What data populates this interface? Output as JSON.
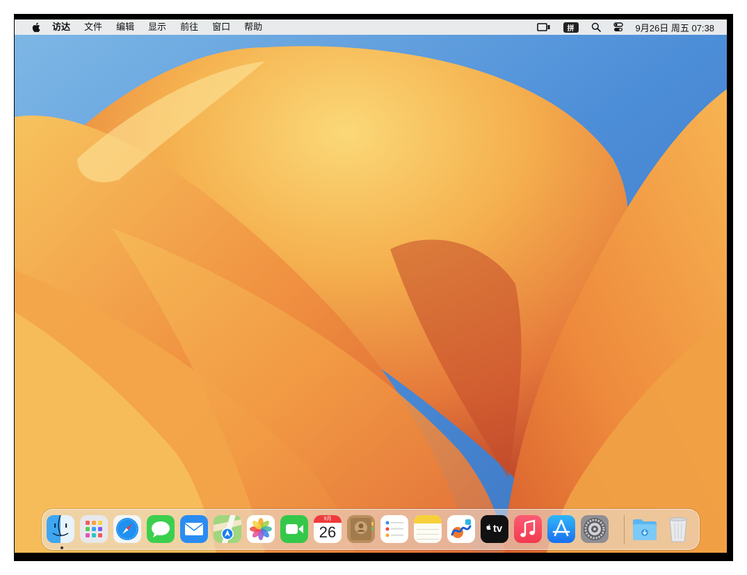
{
  "menubar": {
    "apple_icon": "apple-logo-icon",
    "app_name": "访达",
    "items": [
      "文件",
      "编辑",
      "显示",
      "前往",
      "窗口",
      "帮助"
    ],
    "status_icons": [
      "screen-mirroring-icon",
      "input-method-icon",
      "spotlight-search-icon",
      "control-center-icon"
    ],
    "input_method_label": "拼",
    "clock": "9月26日 周五 07:38"
  },
  "dock": {
    "apps": [
      {
        "name": "finder-icon",
        "running": true
      },
      {
        "name": "launchpad-icon"
      },
      {
        "name": "safari-icon"
      },
      {
        "name": "messages-icon"
      },
      {
        "name": "mail-icon"
      },
      {
        "name": "maps-icon"
      },
      {
        "name": "photos-icon"
      },
      {
        "name": "facetime-icon"
      },
      {
        "name": "calendar-icon"
      },
      {
        "name": "contacts-icon"
      },
      {
        "name": "reminders-icon"
      },
      {
        "name": "notes-icon"
      },
      {
        "name": "freeform-icon"
      },
      {
        "name": "apple-tv-icon"
      },
      {
        "name": "music-icon"
      },
      {
        "name": "app-store-icon"
      },
      {
        "name": "system-settings-icon"
      },
      {
        "name": "downloads-folder-icon"
      },
      {
        "name": "trash-icon"
      }
    ],
    "calendar": {
      "month": "9月",
      "day": "26"
    },
    "tv_label": "tv"
  },
  "colors": {
    "wallpaper_blue": "#4f8fd8",
    "wallpaper_orange": "#f0a040",
    "wallpaper_red": "#c84a28",
    "menubar_bg": "#ececec"
  }
}
